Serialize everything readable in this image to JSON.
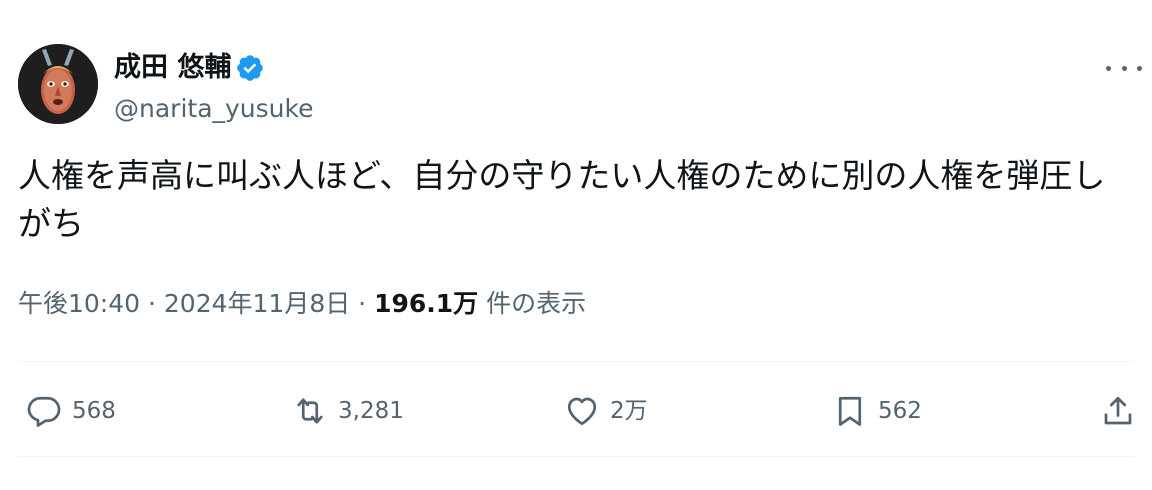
{
  "author": {
    "display_name": "成田 悠輔",
    "handle": "@narita_yusuke",
    "verified": true,
    "verified_color": "#1d9bf0"
  },
  "tweet": {
    "text": "人権を声高に叫ぶ人ほど、自分の守りたい人権のために別の人権を弾圧しがち"
  },
  "meta": {
    "time": "午後10:40",
    "sep1": " · ",
    "date": "2024年11月8日",
    "sep2": " · ",
    "views_count": "196.1万",
    "views_label": " 件の表示"
  },
  "actions": {
    "reply": {
      "icon": "reply-icon",
      "count": "568"
    },
    "repost": {
      "icon": "repost-icon",
      "count": "3,281"
    },
    "like": {
      "icon": "heart-icon",
      "count": "2万"
    },
    "bookmark": {
      "icon": "bookmark-icon",
      "count": "562"
    },
    "share": {
      "icon": "share-icon"
    }
  },
  "colors": {
    "text_primary": "#0f1419",
    "text_secondary": "#536471",
    "divider": "#eff3f4"
  }
}
